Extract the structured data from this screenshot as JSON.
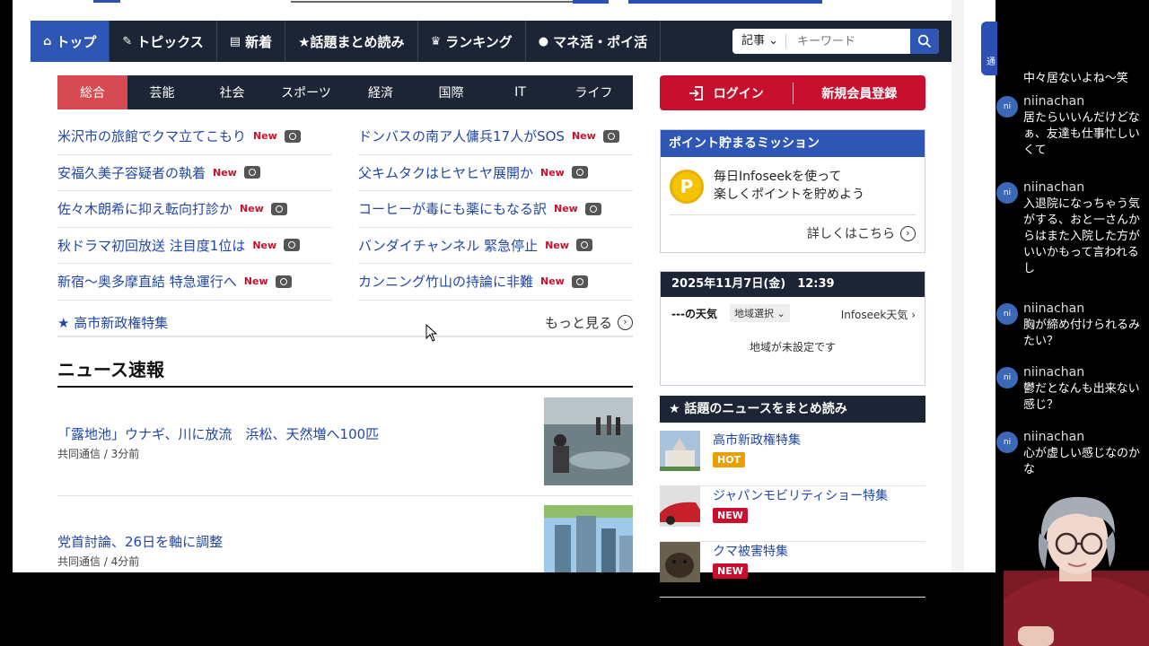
{
  "nav": {
    "items": [
      {
        "label": "トップ",
        "icon": "home-icon"
      },
      {
        "label": "トピックス",
        "icon": "pencil-icon"
      },
      {
        "label": "新着",
        "icon": "document-icon"
      },
      {
        "label": "★話題まとめ読み",
        "icon": ""
      },
      {
        "label": "ランキング",
        "icon": "crown-icon"
      },
      {
        "label": "マネ活・ポイ活",
        "icon": "piggy-bank-icon"
      }
    ],
    "search": {
      "category": "記事",
      "placeholder": "キーワード"
    }
  },
  "categories": [
    "総合",
    "芸能",
    "社会",
    "スポーツ",
    "経済",
    "国際",
    "IT",
    "ライフ"
  ],
  "headlines": {
    "left": [
      "米沢市の旅館でクマ立てこもり",
      "安福久美子容疑者の執着",
      "佐々木朗希に抑え転向打診か",
      "秋ドラマ初回放送 注目度1位は",
      "新宿〜奥多摩直結 特急運行へ"
    ],
    "right": [
      "ドンバスの南ア人傭兵17人がSOS",
      "父キムタクはヒヤヒヤ展開か",
      "コーヒーが毒にも薬にもなる訳",
      "バンダイチャンネル 緊急停止",
      "カンニング竹山の持論に非難"
    ],
    "new_label": "New",
    "feature": "★ 高市新政権特集",
    "more": "もっと見る"
  },
  "news_flash": {
    "title": "ニュース速報",
    "articles": [
      {
        "title": "「露地池」ウナギ、川に放流　浜松、天然増へ100匹",
        "source": "共同通信 / 3分前"
      },
      {
        "title": "党首討論、26日を軸に調整",
        "source": "共同通信 / 4分前"
      }
    ]
  },
  "account": {
    "login": "ログイン",
    "register": "新規会員登録"
  },
  "mission": {
    "header": "ポイント貯まるミッション",
    "coin": "P",
    "line1": "毎日Infoseekを使って",
    "line2": "楽しくポイントを貯めよう",
    "detail": "詳しくはこちら"
  },
  "weather": {
    "datetime": "2025年11月7日(金)　12:39",
    "label": "---の天気",
    "region_select": "地域選択",
    "provider": "Infoseek天気",
    "message": "地域が未設定です"
  },
  "matome": {
    "header": "★ 話題のニュースをまとめ読み",
    "items": [
      {
        "title": "高市新政権特集",
        "badge": "HOT"
      },
      {
        "title": "ジャパンモビリティショー特集",
        "badge": "NEW"
      },
      {
        "title": "クマ被害特集",
        "badge": "NEW"
      }
    ]
  },
  "chat": {
    "top_fragment": "中々居ないよね〜笑",
    "messages": [
      {
        "user": "niinachan",
        "text": "居たらいいんだけどなぁ、友達も仕事忙しいくて"
      },
      {
        "user": "niinachan",
        "text": "入退院になっちゃう気がする、おと一さんからはまた入院した方がいいかもって言われるし"
      },
      {
        "user": "niinachan",
        "text": "胸が締め付けられるみたい？"
      },
      {
        "user": "niinachan",
        "text": "鬱だとなんも出来ない感じ？"
      },
      {
        "user": "niinachan",
        "text": "心が虚しい感じなのかな"
      }
    ],
    "avatar_initials": "ni"
  },
  "side_tab": "通",
  "colors": {
    "nav_bg": "#1c2535",
    "accent_blue": "#2e57b5",
    "accent_red": "#c8102e",
    "tab_active": "#d84a52",
    "link": "#2146a6",
    "hot": "#e8a000"
  }
}
